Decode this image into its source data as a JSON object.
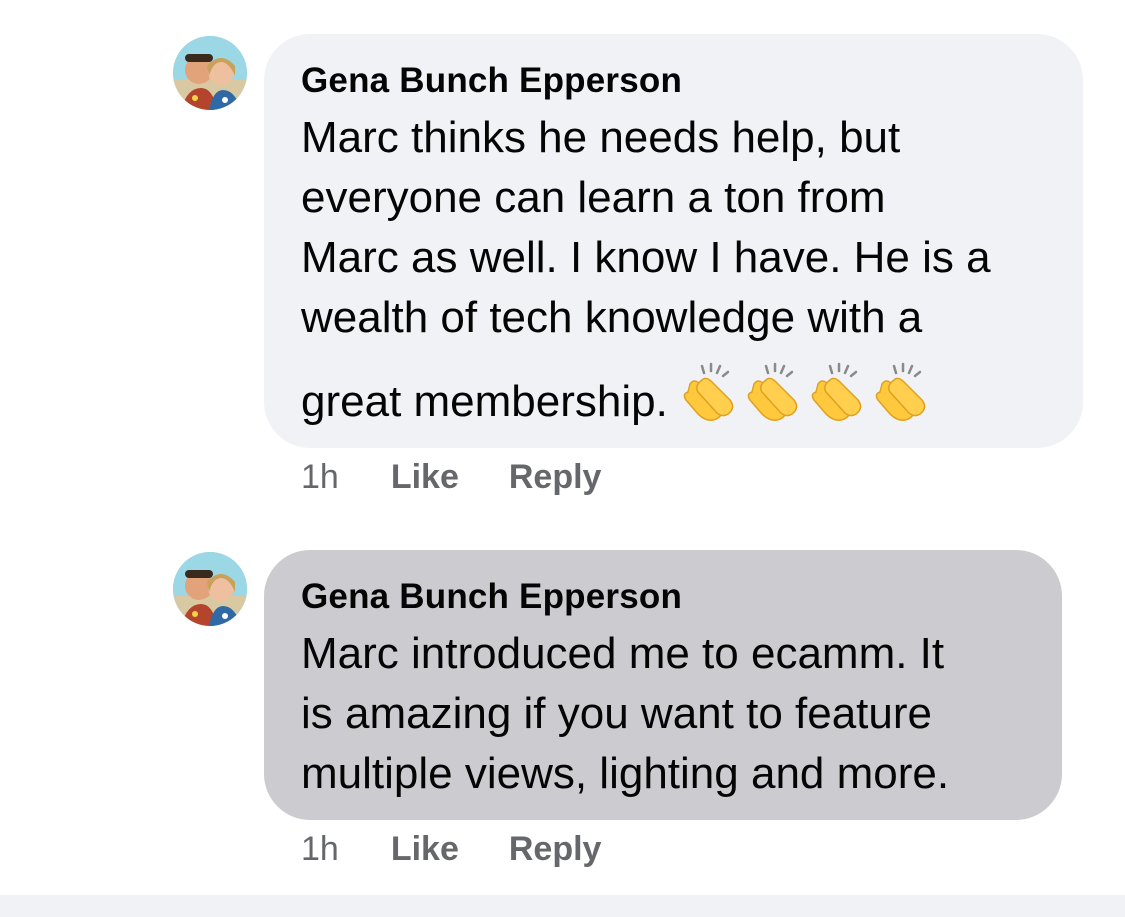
{
  "comments": [
    {
      "author": "Gena Bunch Epperson",
      "lines": [
        "Marc thinks he needs help, but",
        "everyone can learn a ton from",
        "Marc as well. I know I have. He is a",
        "wealth of tech knowledge with a",
        "great membership."
      ],
      "emoji": [
        "clapping-hands",
        "clapping-hands",
        "clapping-hands",
        "clapping-hands"
      ],
      "timestamp": "1h",
      "like_label": "Like",
      "reply_label": "Reply"
    },
    {
      "author": "Gena Bunch Epperson",
      "lines": [
        "Marc introduced me to ecamm. It",
        "is amazing if you want to feature",
        "multiple views, lighting and more."
      ],
      "timestamp": "1h",
      "like_label": "Like",
      "reply_label": "Reply"
    }
  ],
  "colors": {
    "bubble_default": "#f0f2f5",
    "bubble_highlighted": "#ccccd0",
    "meta_text": "#65676b",
    "clap_yellow": "#ffc83d"
  }
}
